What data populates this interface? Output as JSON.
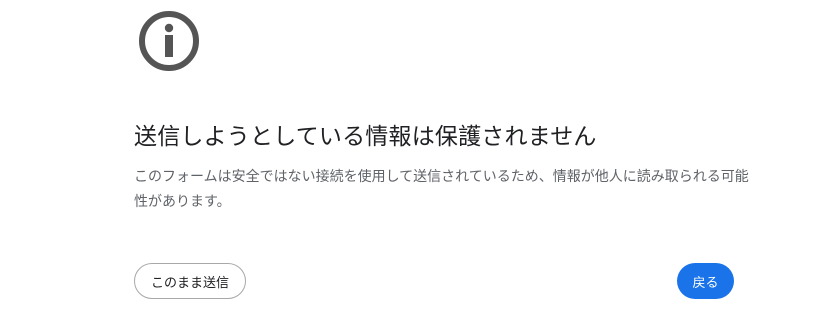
{
  "icon": "info-icon",
  "colors": {
    "icon": "#555555",
    "title": "#202124",
    "body_text": "#5f6368",
    "primary_button": "#1a73e8",
    "secondary_border": "#a8a8a8"
  },
  "warning": {
    "title": "送信しようとしている情報は保護されません",
    "description": "このフォームは安全ではない接続を使用して送信されているため、情報が他人に読み取られる可能性があります。"
  },
  "actions": {
    "send_anyway_label": "このまま送信",
    "back_label": "戻る"
  }
}
